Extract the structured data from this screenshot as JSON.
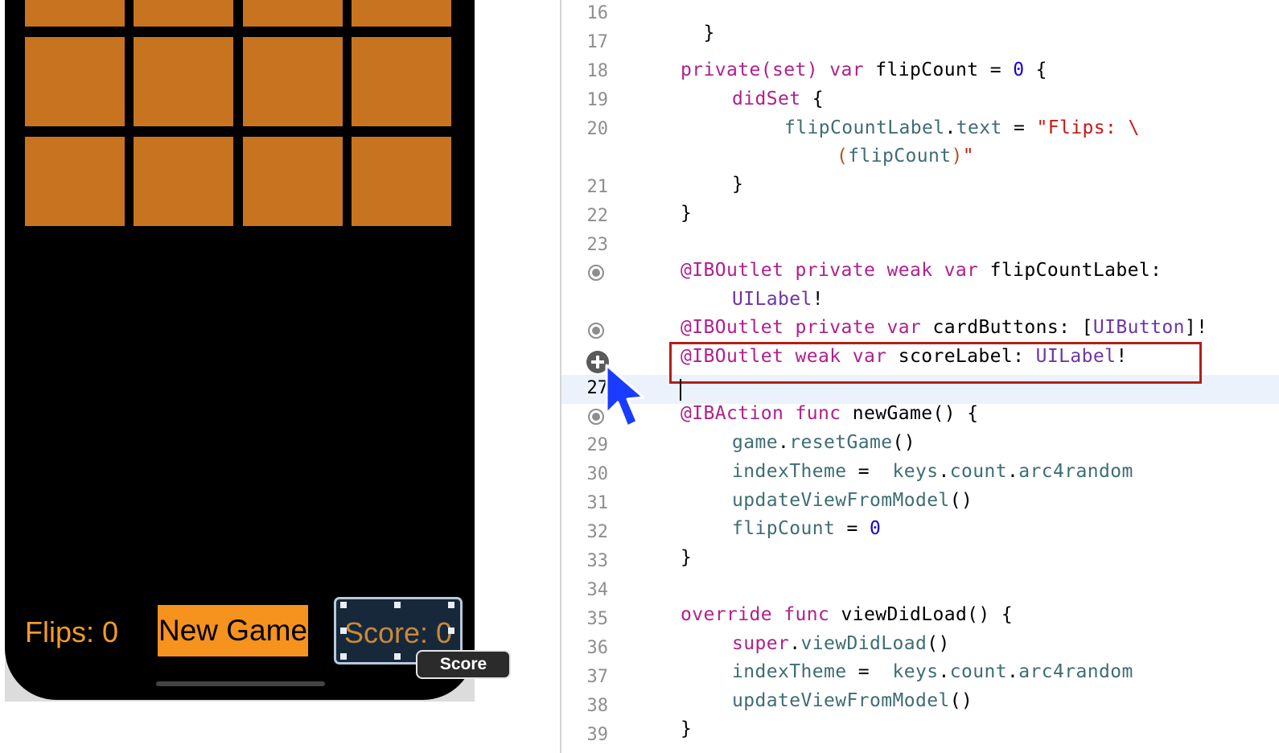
{
  "simulator": {
    "flips_label": "Flips: 0",
    "new_game_label": "New Game",
    "score_label": "Score: 0",
    "tooltip": "Score",
    "card_color": "#c8731f",
    "accent_color": "#f6921e"
  },
  "editor": {
    "current_line_number": "27",
    "line_numbers": [
      "16",
      "17",
      "18",
      "19",
      "20",
      "21",
      "22",
      "23",
      "27",
      "29",
      "30",
      "31",
      "32",
      "33",
      "34",
      "35",
      "36",
      "37",
      "38",
      "39"
    ],
    "lines": {
      "l16": {
        "t": "}"
      },
      "l18": {
        "a": "private(set) var",
        "b": " flipCount = ",
        "c": "0",
        "d": " {"
      },
      "l19": {
        "a": "didSet",
        "b": " {"
      },
      "l20": {
        "a": "flipCountLabel",
        "b": ".",
        "c": "text",
        "d": " = ",
        "e": "\"Flips: \\"
      },
      "l20b": {
        "a": "(",
        "b": "flipCount",
        "c": ")",
        "d": "\""
      },
      "l21": {
        "t": "}"
      },
      "l22": {
        "t": "}"
      },
      "l24": {
        "a": "@IBOutlet private weak var",
        "b": " flipCountLabel:"
      },
      "l24b": {
        "a": "UILabel",
        "b": "!"
      },
      "l25": {
        "a": "@IBOutlet private var",
        "b": " cardButtons: [",
        "c": "UIButton",
        "d": "]!"
      },
      "l26": {
        "a": "@IBOutlet weak var",
        "b": " scoreLabel: ",
        "c": "UILabel",
        "d": "!"
      },
      "l28": {
        "a": "@IBAction func",
        "b": " newGame() {"
      },
      "l29": {
        "a": "game",
        "b": ".",
        "c": "resetGame",
        "d": "()"
      },
      "l30": {
        "a": "indexTheme",
        "b": " =  ",
        "c": "keys",
        "d": ".",
        "e": "count",
        "f": ".",
        "g": "arc4random"
      },
      "l31": {
        "a": "updateViewFromModel",
        "b": "()"
      },
      "l32": {
        "a": "flipCount",
        "b": " = ",
        "c": "0"
      },
      "l33": {
        "t": "}"
      },
      "l35": {
        "a": "override func",
        "b": " viewDidLoad() {"
      },
      "l36": {
        "a": "super",
        "b": ".",
        "c": "viewDidLoad",
        "d": "()"
      },
      "l37": {
        "a": "indexTheme",
        "b": " =  ",
        "c": "keys",
        "d": ".",
        "e": "count",
        "f": ".",
        "g": "arc4random"
      },
      "l38": {
        "a": "updateViewFromModel",
        "b": "()"
      },
      "l39": {
        "t": "}"
      }
    }
  }
}
